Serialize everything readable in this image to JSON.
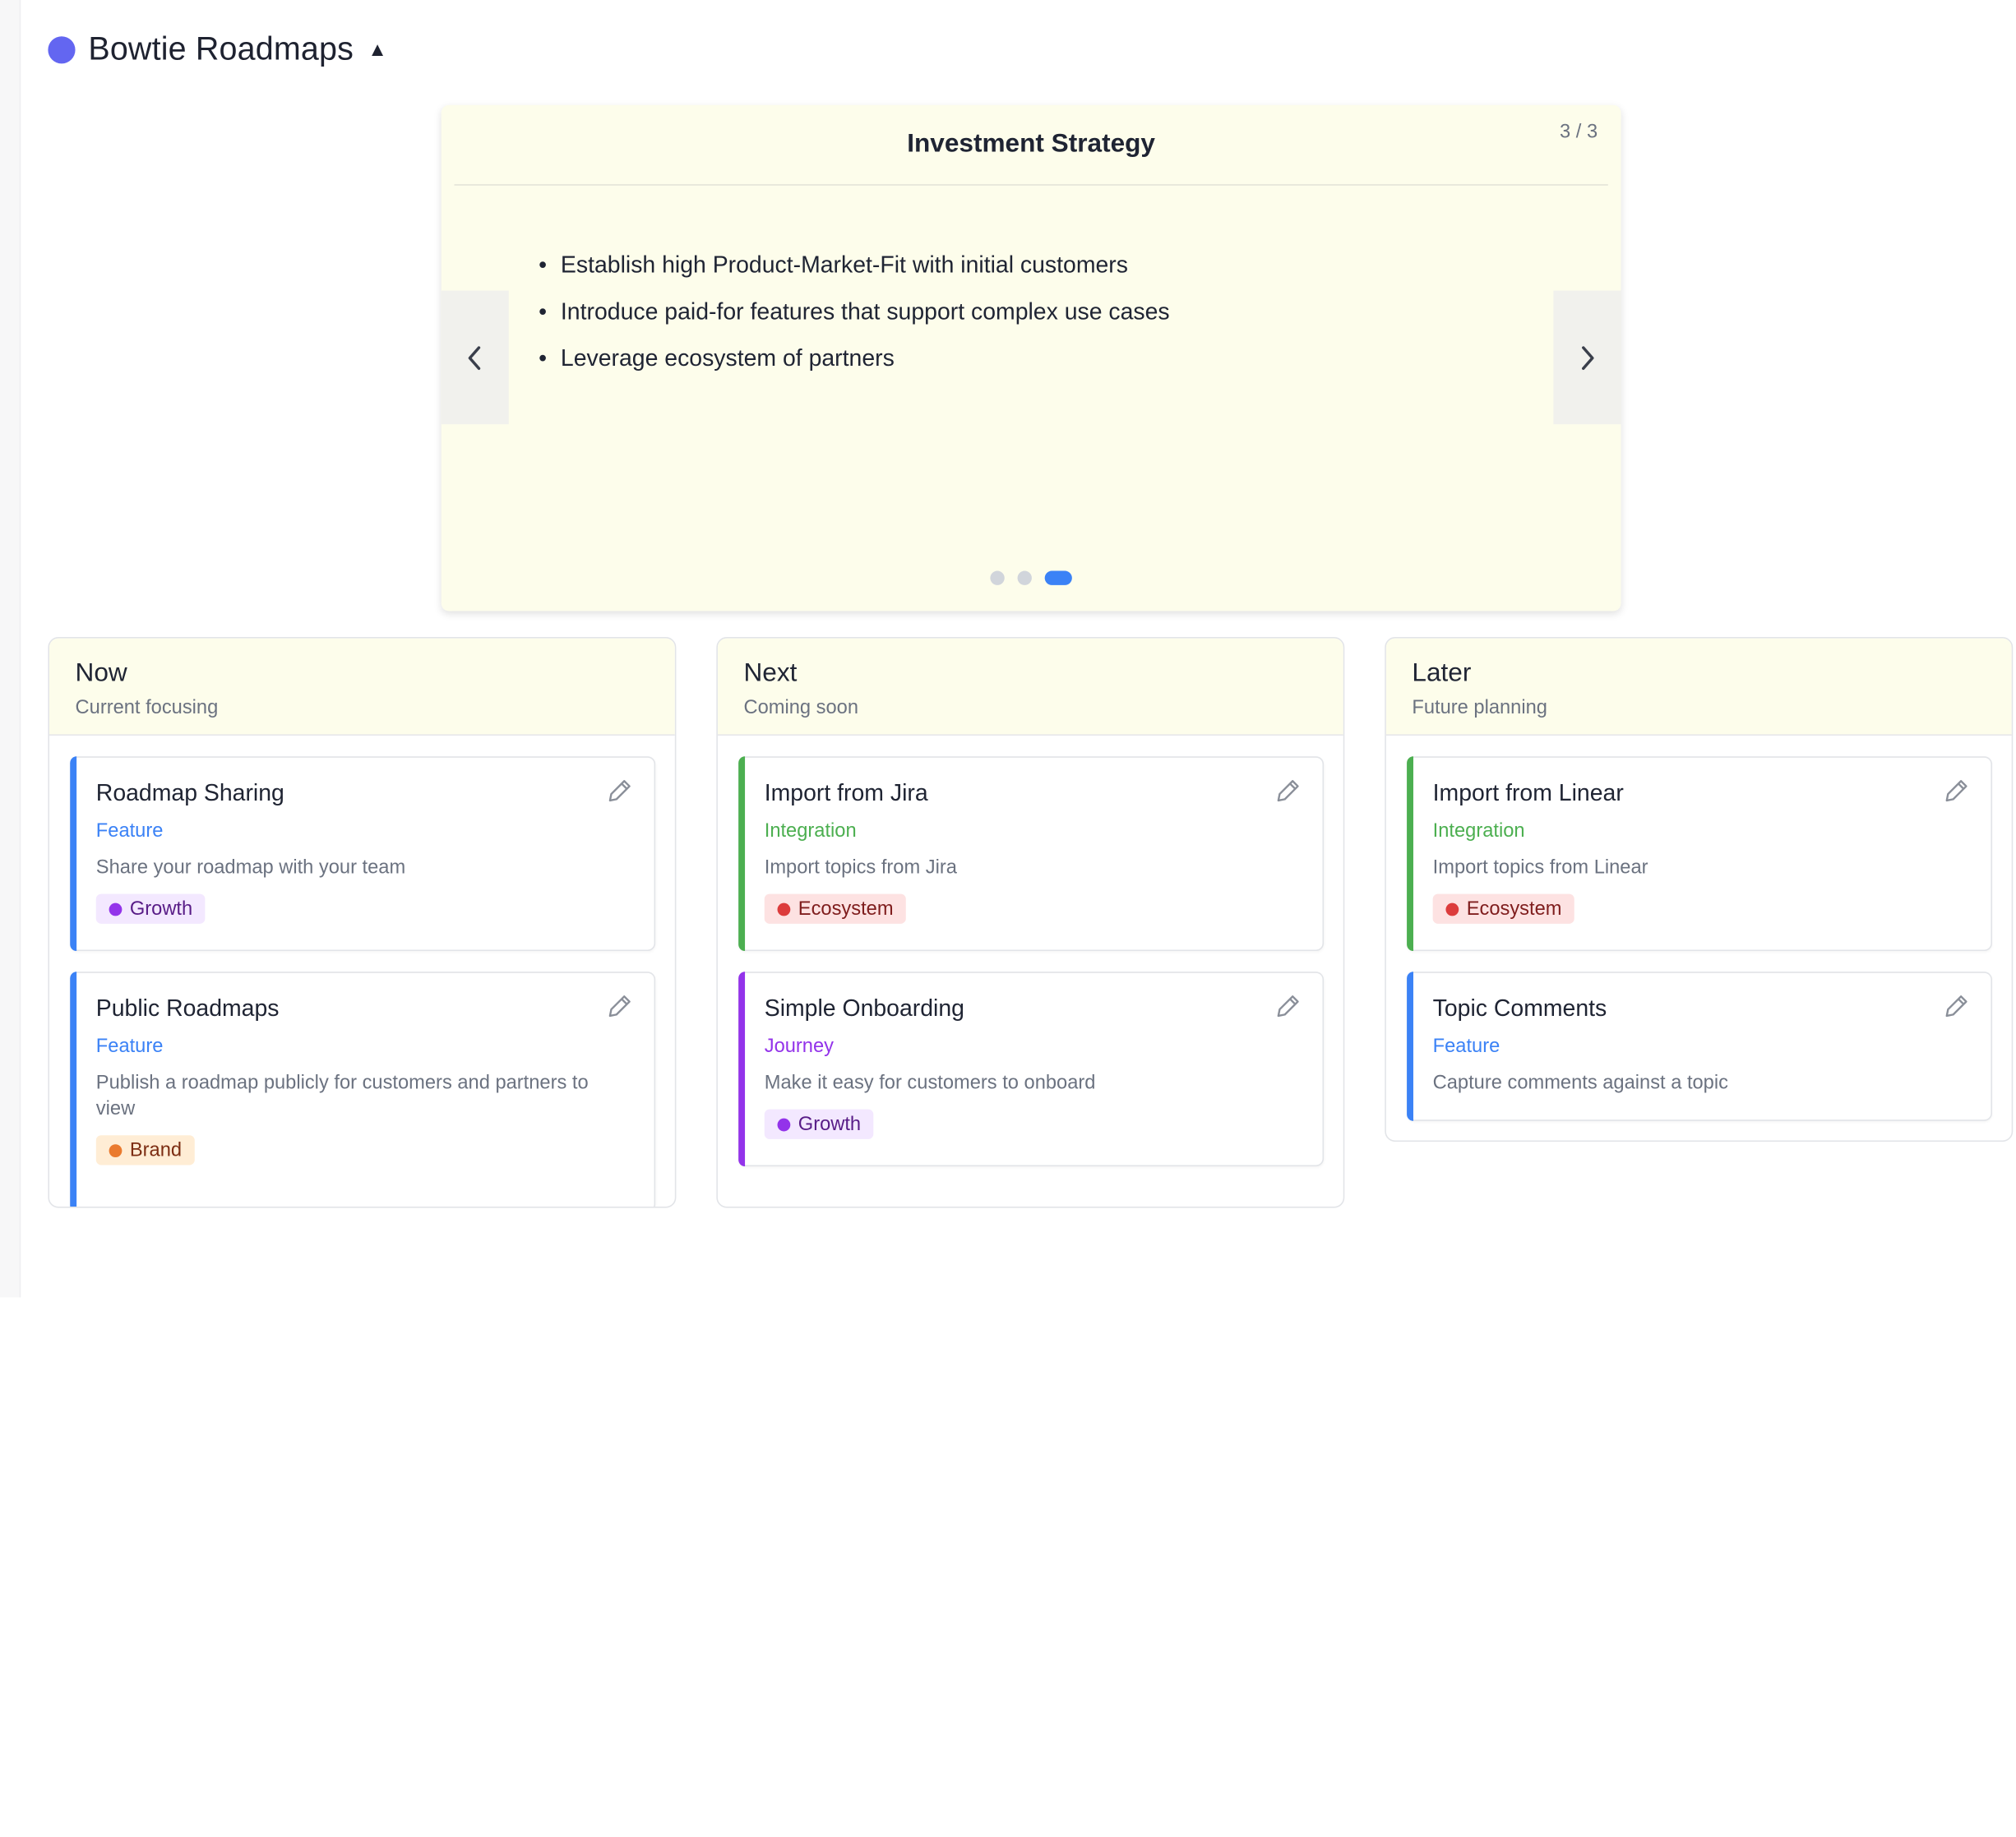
{
  "header": {
    "title": "Bowtie Roadmaps",
    "caret": "▲"
  },
  "carousel": {
    "counter": "3 / 3",
    "title": "Investment Strategy",
    "bullets": [
      "Establish high Product-Market-Fit with initial customers",
      "Introduce paid-for features that support complex use cases",
      "Leverage ecosystem of partners"
    ],
    "active_slide": 3,
    "total_slides": 3
  },
  "columns": [
    {
      "title": "Now",
      "subtitle": "Current focusing",
      "cards": [
        {
          "title": "Roadmap Sharing",
          "type": "Feature",
          "description": "Share your roadmap with your team",
          "tag": "Growth"
        },
        {
          "title": "Public Roadmaps",
          "type": "Feature",
          "description": "Publish a roadmap publicly for customers and partners to view",
          "tag": "Brand"
        }
      ]
    },
    {
      "title": "Next",
      "subtitle": "Coming soon",
      "cards": [
        {
          "title": "Import from Jira",
          "type": "Integration",
          "description": "Import topics from Jira",
          "tag": "Ecosystem"
        },
        {
          "title": "Simple Onboarding",
          "type": "Journey",
          "description": "Make it easy for customers to onboard",
          "tag": "Growth"
        }
      ]
    },
    {
      "title": "Later",
      "subtitle": "Future planning",
      "cards": [
        {
          "title": "Import from Linear",
          "type": "Integration",
          "description": "Import topics from Linear",
          "tag": "Ecosystem"
        },
        {
          "title": "Topic Comments",
          "type": "Feature",
          "description": "Capture comments against a topic"
        }
      ]
    }
  ],
  "colors": {
    "brand": "#6366f1",
    "feature": "#3b82f6",
    "integration": "#4caf50",
    "journey": "#9333ea",
    "panel_bg": "#fdfdeb"
  }
}
